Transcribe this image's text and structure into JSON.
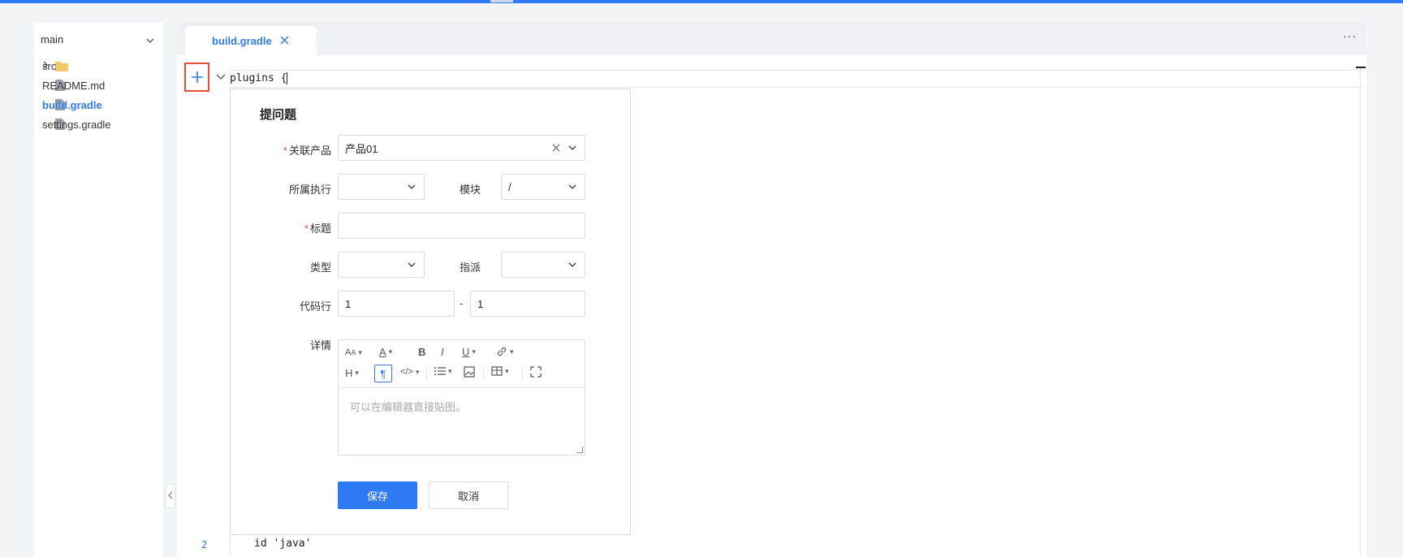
{
  "branch": {
    "name": "main"
  },
  "file_tree": [
    {
      "label": "src",
      "icon": "folder-icon",
      "expandable": true
    },
    {
      "label": "README.md",
      "icon": "file-icon"
    },
    {
      "label": "build.gradle",
      "icon": "file-icon",
      "active": true
    },
    {
      "label": "settings.gradle",
      "icon": "file-icon"
    }
  ],
  "tab": {
    "label": "build.gradle"
  },
  "more_label": "···",
  "editor": {
    "line1": "plugins {",
    "line2_number": "2",
    "line2": "id 'java'"
  },
  "form": {
    "title": "提问题",
    "product_label": "关联产品",
    "product_value": "产品01",
    "execution_label": "所属执行",
    "execution_value": "",
    "module_label": "模块",
    "module_value": "/",
    "title_label": "标题",
    "title_value": "",
    "type_label": "类型",
    "type_value": "",
    "assign_label": "指派",
    "assign_value": "",
    "code_label": "代码行",
    "code_from": "1",
    "code_to": "1",
    "code_sep": "-",
    "detail_label": "详情",
    "detail_placeholder": "可以在编辑器直接贴图。",
    "save_label": "保存",
    "cancel_label": "取消"
  },
  "colors": {
    "accent": "#2f7af3",
    "required": "#e74c3c",
    "highlight_border": "#e74c3c"
  }
}
